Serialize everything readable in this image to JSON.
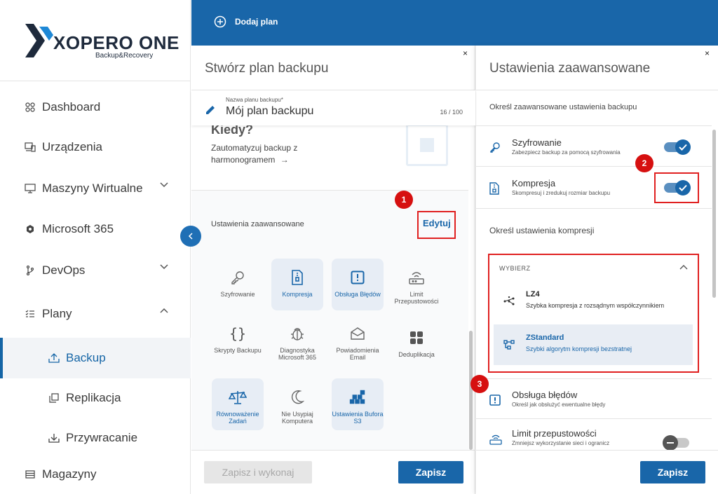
{
  "brand": {
    "name": "XOPERO ONE",
    "tagline": "Backup&Recovery"
  },
  "sidebar": {
    "items": [
      {
        "label": "Dashboard",
        "icon": "dashboard-icon"
      },
      {
        "label": "Urządzenia",
        "icon": "devices-icon"
      },
      {
        "label": "Maszyny Wirtualne",
        "icon": "monitor-icon"
      },
      {
        "label": "Microsoft 365",
        "icon": "microsoft-icon"
      },
      {
        "label": "DevOps",
        "icon": "branch-icon"
      },
      {
        "label": "Plany",
        "icon": "list-icon"
      },
      {
        "label": "Backup",
        "icon": "backup-icon"
      },
      {
        "label": "Replikacja",
        "icon": "copy-icon"
      },
      {
        "label": "Przywracanie",
        "icon": "restore-icon"
      },
      {
        "label": "Magazyny",
        "icon": "storage-icon"
      }
    ]
  },
  "topbar": {
    "add_plan": "Dodaj plan"
  },
  "create_panel": {
    "title": "Stwórz plan backupu",
    "close": "×",
    "name_field": {
      "label": "Nazwa planu backupu*",
      "value": "Mój plan backupu",
      "counter": "16 / 100"
    },
    "partial_heading": "Kiedy?",
    "automate_text": "Zautomatyzuj backup z harmonogramem",
    "arrow": "→",
    "advanced_title": "Ustawienia zaawansowane",
    "edit_label": "Edytuj",
    "tiles": [
      {
        "label": "Szyfrowanie",
        "icon": "key-icon",
        "active": false
      },
      {
        "label": "Kompresja",
        "icon": "compress-file-icon",
        "active": true
      },
      {
        "label": "Obsługa Błędów",
        "icon": "alert-square-icon",
        "active": true
      },
      {
        "label": "Limit Przepustowości",
        "icon": "router-icon",
        "active": false
      },
      {
        "label": "Skrypty Backupu",
        "icon": "braces-icon",
        "active": false
      },
      {
        "label": "Diagnostyka Microsoft 365",
        "icon": "bug-icon",
        "active": false
      },
      {
        "label": "Powiadomienia Email",
        "icon": "envelope-icon",
        "active": false
      },
      {
        "label": "Deduplikacja",
        "icon": "grid-icon",
        "active": false
      },
      {
        "label": "Równoważenie Zadań",
        "icon": "scale-icon",
        "active": true
      },
      {
        "label": "Nie Usypiaj Komputera",
        "icon": "moon-icon",
        "active": false
      },
      {
        "label": "Ustawienia Bufora S3",
        "icon": "cubes-icon",
        "active": true
      }
    ],
    "btn_save_run": "Zapisz i wykonaj",
    "btn_save": "Zapisz"
  },
  "advanced_panel": {
    "title": "Ustawienia zaawansowane",
    "close": "×",
    "subtitle": "Określ zaawansowane ustawienia backupu",
    "options": [
      {
        "title": "Szyfrowanie",
        "desc": "Zabezpiecz backup za pomocą szyfrowania",
        "icon": "key-icon",
        "enabled": true
      },
      {
        "title": "Kompresja",
        "desc": "Skompresuj i zredukuj rozmiar backupu",
        "icon": "compress-file-icon",
        "enabled": true
      }
    ],
    "compression_title": "Określ ustawienia kompresji",
    "dropdown": {
      "header": "WYBIERZ",
      "items": [
        {
          "title": "LZ4",
          "desc": "Szybka kompresja z rozsądnym współczynnikiem",
          "icon": "nodes-icon",
          "selected": false
        },
        {
          "title": "ZStandard",
          "desc": "Szybki algorytm kompresji bezstratnej",
          "icon": "flow-icon",
          "selected": true
        }
      ]
    },
    "more_options": [
      {
        "title": "Obsługa błędów",
        "desc": "Określ jak obsłużyć ewentualne błędy",
        "icon": "alert-square-icon"
      },
      {
        "title": "Limit przepustowości",
        "desc": "Zmniejsz wykorzystanie sieci i ogranicz",
        "icon": "router-icon",
        "enabled": false
      }
    ],
    "btn_save": "Zapisz"
  },
  "annotations": [
    "1",
    "2",
    "3"
  ],
  "colors": {
    "primary": "#1966a9",
    "annotation": "#d61010",
    "active_tile": "#e7edf5"
  }
}
